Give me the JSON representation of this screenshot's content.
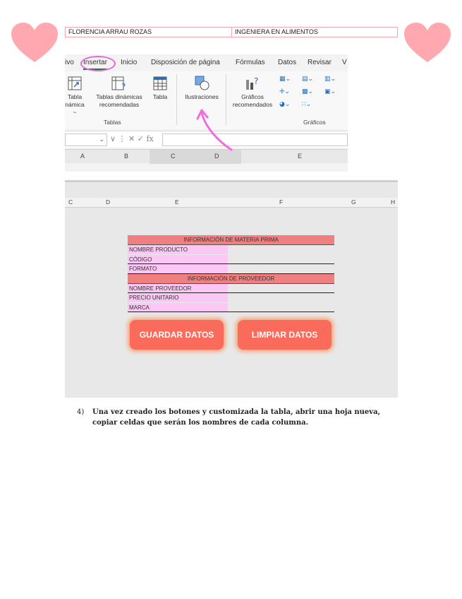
{
  "header": {
    "author": "FLORENCIA ARRAU ROZAS",
    "career": "INGENIERA EN ALIMENTOS"
  },
  "decorations": {
    "hearts": [
      "heart-left",
      "heart-right"
    ],
    "heart_color": "#ffa8b0"
  },
  "ribbon": {
    "tabs": [
      "ivo",
      "Insertar",
      "Inicio",
      "Disposición de página",
      "Fórmulas",
      "Datos",
      "Revisar",
      "V"
    ],
    "active_tab": "Insertar",
    "buttons": {
      "tabla": [
        "Tabla",
        "námica ~"
      ],
      "tablas_recomendadas": [
        "Tablas dinámicas",
        "recomendadas"
      ],
      "tabla_simple": "Tabla",
      "ilustraciones": "Ilustraciones",
      "graficos": [
        "Gráficos",
        "recomendados"
      ]
    },
    "groups": {
      "tablas": "Tablas",
      "graficos": "Gráficos"
    },
    "formula_bar": {
      "symbols": "∨  ⋮  ✕  ✓  fx"
    },
    "columns": [
      "A",
      "B",
      "C",
      "D",
      "E"
    ],
    "accent_color": "#217346",
    "highlight_color": "#e668d8"
  },
  "sheet": {
    "columns": [
      "C",
      "D",
      "E",
      "F",
      "G",
      "H"
    ],
    "section1_title": "INFORMACIÓN DE MATERIA PRIMA",
    "section1_rows": [
      "NOMBRE PRODUCTO",
      "CÓDIGO",
      "FORMATO"
    ],
    "section2_title": "INFORMACIÓN DE PROVEEDOR",
    "section2_rows": [
      "NOMBRE PROVEEDOR",
      "PRECIO UNITARIO",
      "MARCA"
    ],
    "btn_save": "GUARDAR DATOS",
    "btn_clear": "LIMPIAR DATOS",
    "header_color": "#f08080",
    "label_color": "#fbc8f5",
    "button_color": "#fa6b5b"
  },
  "step": {
    "number": "4)",
    "text": "Una vez creado los botones y customizada la tabla, abrir una hoja nueva, copiar celdas que serán los nombres de cada columna."
  }
}
